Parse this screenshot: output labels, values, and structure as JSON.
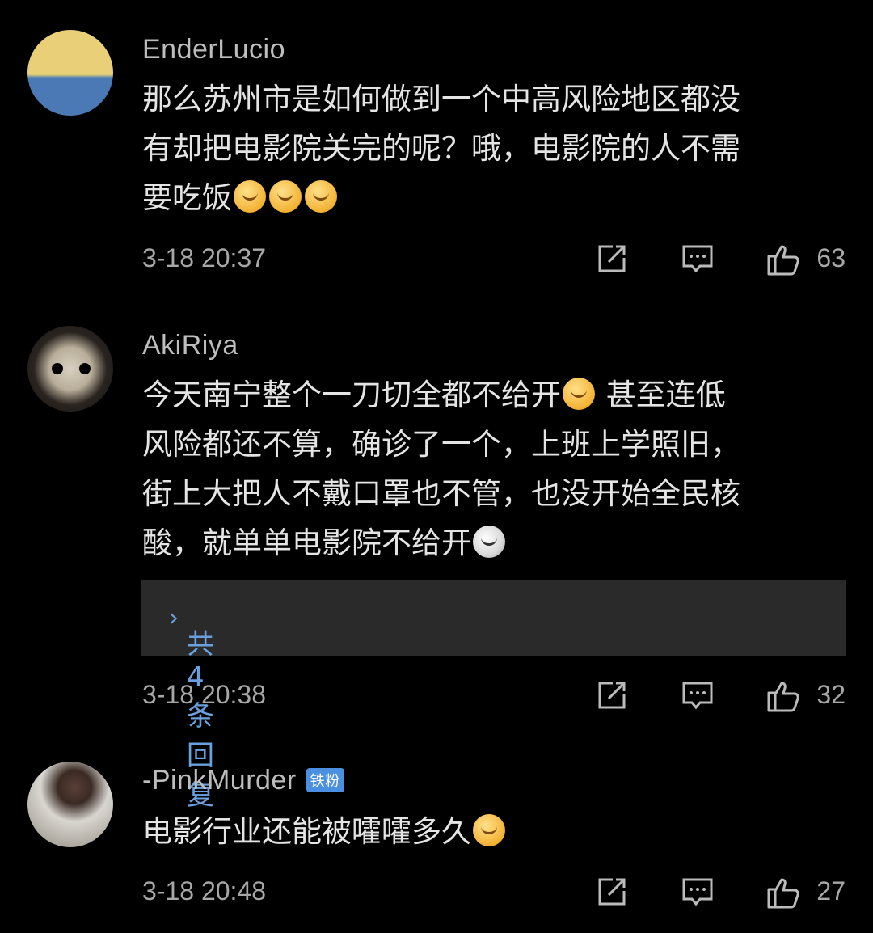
{
  "comments": [
    {
      "username": "EnderLucio",
      "lines": [
        "那么苏州市是如何做到一个中高风险地区都没",
        "有却把电影院关完的呢？哦，电影院的人不需",
        "要吃饭"
      ],
      "emojis": [
        "cold-sweat-emoji",
        "cold-sweat-emoji",
        "cold-sweat-emoji"
      ],
      "time": "3-18 20:37",
      "likes": "63"
    },
    {
      "username": "AkiRiya",
      "line1_a": "今天南宁整个一刀切全都不给开",
      "line1_emoji": "thinking-emoji",
      "line1_b": "甚至连低",
      "line2": "风险都还不算，确诊了一个，上班上学照旧，",
      "line3": "街上大把人不戴口罩也不管，也没开始全民核",
      "line4": "酸，就单单电影院不给开",
      "line4_emoji": "dog-emoji",
      "replies_label": "共4条回复",
      "time": "3-18 20:38",
      "likes": "32"
    },
    {
      "username": "-PinkMurder",
      "badge": "铁粉",
      "text": "电影行业还能被嚯嚯多久",
      "emoji": "thinking-emoji",
      "time": "3-18 20:48",
      "likes": "27"
    }
  ],
  "icons": {
    "share": "share-icon",
    "reply": "comment-icon",
    "like": "thumbs-up-icon"
  },
  "colors": {
    "background": "#000000",
    "link": "#6aa0de",
    "reply_box": "#2a2a2a",
    "badge": "#4a8fe0"
  }
}
